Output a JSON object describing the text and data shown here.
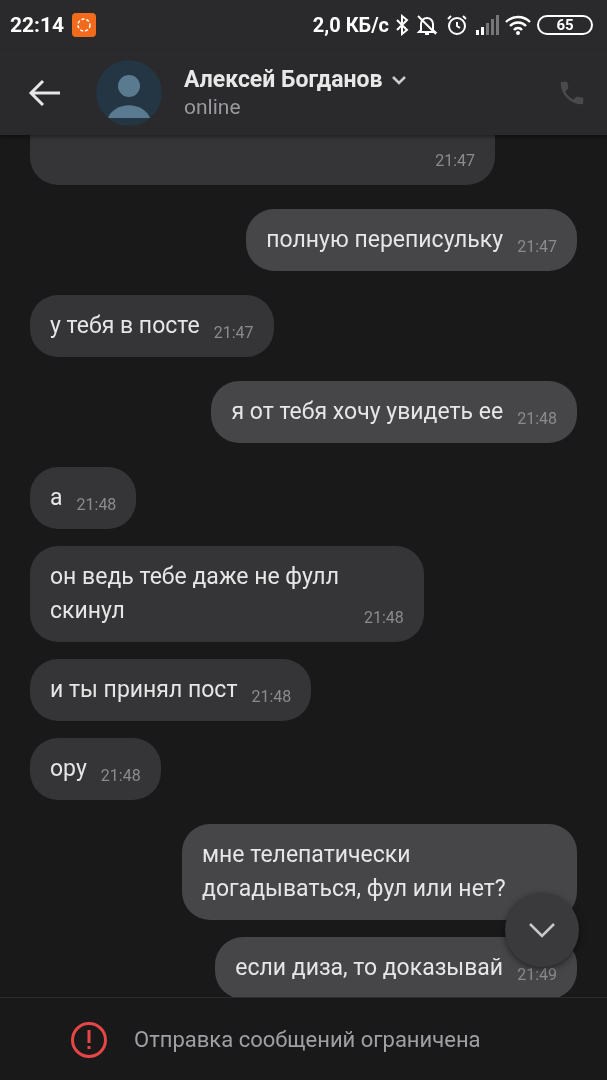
{
  "status_bar": {
    "time": "22:14",
    "speed": "2,0 КБ/с",
    "battery": "65"
  },
  "header": {
    "name": "Алексей Богданов",
    "status": "online"
  },
  "messages": [
    {
      "outgoing": false,
      "time": "21:47",
      "kind": "cut"
    },
    {
      "outgoing": true,
      "text": "полную переписульку",
      "time": "21:47",
      "kind": "plain"
    },
    {
      "outgoing": false,
      "text": "у тебя в посте",
      "time": "21:47",
      "kind": "plain"
    },
    {
      "outgoing": true,
      "text": "я от тебя хочу увидеть ее",
      "time": "21:48",
      "kind": "plain"
    },
    {
      "outgoing": false,
      "text": "а",
      "time": "21:48",
      "kind": "plain"
    },
    {
      "outgoing": false,
      "text": "он ведь тебе даже не фулл скинул",
      "time": "21:48",
      "kind": "plain"
    },
    {
      "outgoing": false,
      "text": "и ты принял пост",
      "time": "21:48",
      "kind": "plain"
    },
    {
      "outgoing": false,
      "text": "ору",
      "time": "21:48",
      "kind": "plain"
    },
    {
      "outgoing": true,
      "text": "мне телепатически догадываться, фул или нет?",
      "kind": "plain"
    },
    {
      "outgoing": true,
      "text": "если диза, то доказывай",
      "time": "21:49",
      "kind": "plain"
    }
  ],
  "footer": {
    "notice": "Отправка сообщений ограничена"
  }
}
